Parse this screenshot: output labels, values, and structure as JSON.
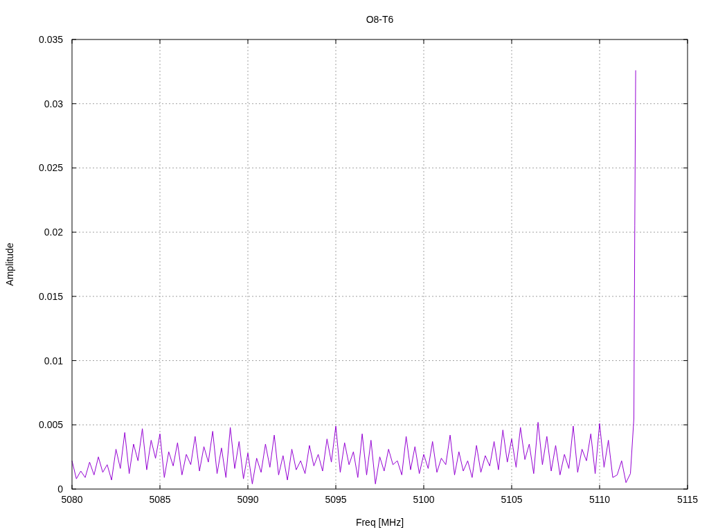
{
  "chart_data": {
    "type": "line",
    "title": "O8-T6",
    "xlabel": "Freq [MHz]",
    "ylabel": "Amplitude",
    "grid": true,
    "xlim": [
      5080,
      5115
    ],
    "ylim": [
      0,
      0.035
    ],
    "xticks": [
      5080,
      5085,
      5090,
      5095,
      5100,
      5105,
      5110,
      5115
    ],
    "yticks": [
      0,
      0.005,
      0.01,
      0.015,
      0.02,
      0.025,
      0.03,
      0.035
    ],
    "x": [
      5080,
      5080.25,
      5080.5,
      5080.75,
      5081,
      5081.25,
      5081.5,
      5081.75,
      5082,
      5082.25,
      5082.5,
      5082.75,
      5083,
      5083.25,
      5083.5,
      5083.75,
      5084,
      5084.25,
      5084.5,
      5084.75,
      5085,
      5085.25,
      5085.5,
      5085.75,
      5086,
      5086.25,
      5086.5,
      5086.75,
      5087,
      5087.25,
      5087.5,
      5087.75,
      5088,
      5088.25,
      5088.5,
      5088.75,
      5089,
      5089.25,
      5089.5,
      5089.75,
      5090,
      5090.25,
      5090.5,
      5090.75,
      5091,
      5091.25,
      5091.5,
      5091.75,
      5092,
      5092.25,
      5092.5,
      5092.75,
      5093,
      5093.25,
      5093.5,
      5093.75,
      5094,
      5094.25,
      5094.5,
      5094.75,
      5095,
      5095.25,
      5095.5,
      5095.75,
      5096,
      5096.25,
      5096.5,
      5096.75,
      5097,
      5097.25,
      5097.5,
      5097.75,
      5098,
      5098.25,
      5098.5,
      5098.75,
      5099,
      5099.25,
      5099.5,
      5099.75,
      5100,
      5100.25,
      5100.5,
      5100.75,
      5101,
      5101.25,
      5101.5,
      5101.75,
      5102,
      5102.25,
      5102.5,
      5102.75,
      5103,
      5103.25,
      5103.5,
      5103.75,
      5104,
      5104.25,
      5104.5,
      5104.75,
      5105,
      5105.25,
      5105.5,
      5105.75,
      5106,
      5106.25,
      5106.5,
      5106.75,
      5107,
      5107.25,
      5107.5,
      5107.75,
      5108,
      5108.25,
      5108.5,
      5108.75,
      5109,
      5109.25,
      5109.5,
      5109.75,
      5110,
      5110.25,
      5110.5,
      5110.75,
      5111,
      5111.25,
      5111.5,
      5111.75,
      5111.95,
      5112,
      5112.05
    ],
    "series": [
      {
        "color": "#9400d3",
        "values": [
          0.0022,
          0.0008,
          0.0014,
          0.0009,
          0.0021,
          0.0011,
          0.0025,
          0.0013,
          0.0019,
          0.0007,
          0.0031,
          0.0016,
          0.0044,
          0.0012,
          0.0035,
          0.0022,
          0.0047,
          0.0015,
          0.0038,
          0.0024,
          0.0043,
          0.0009,
          0.0029,
          0.0018,
          0.0036,
          0.0011,
          0.0027,
          0.0019,
          0.0041,
          0.0014,
          0.0033,
          0.0021,
          0.0045,
          0.0012,
          0.0032,
          0.0009,
          0.0048,
          0.0016,
          0.0037,
          0.0008,
          0.0028,
          0.0004,
          0.0024,
          0.0013,
          0.0035,
          0.0017,
          0.0042,
          0.0011,
          0.0026,
          0.0007,
          0.0031,
          0.0015,
          0.0022,
          0.0012,
          0.0034,
          0.0018,
          0.0027,
          0.0014,
          0.0039,
          0.0021,
          0.0049,
          0.0013,
          0.0036,
          0.0019,
          0.0029,
          0.0009,
          0.0043,
          0.0011,
          0.0038,
          0.0004,
          0.0025,
          0.0014,
          0.0031,
          0.0019,
          0.0022,
          0.0011,
          0.0041,
          0.0015,
          0.0033,
          0.0012,
          0.0027,
          0.0016,
          0.0037,
          0.0013,
          0.0024,
          0.0019,
          0.0042,
          0.0011,
          0.0029,
          0.0014,
          0.0022,
          0.0009,
          0.0034,
          0.0013,
          0.0026,
          0.0018,
          0.0037,
          0.0015,
          0.0046,
          0.0021,
          0.0039,
          0.0017,
          0.0048,
          0.0023,
          0.0035,
          0.0012,
          0.0052,
          0.0019,
          0.0041,
          0.0014,
          0.0034,
          0.0011,
          0.0027,
          0.0016,
          0.0049,
          0.0013,
          0.0031,
          0.0022,
          0.0043,
          0.0012,
          0.0051,
          0.0017,
          0.0038,
          0.0009,
          0.0011,
          0.0022,
          0.0005,
          0.0012,
          0.0055,
          0.0205,
          0.0326
        ]
      }
    ]
  }
}
